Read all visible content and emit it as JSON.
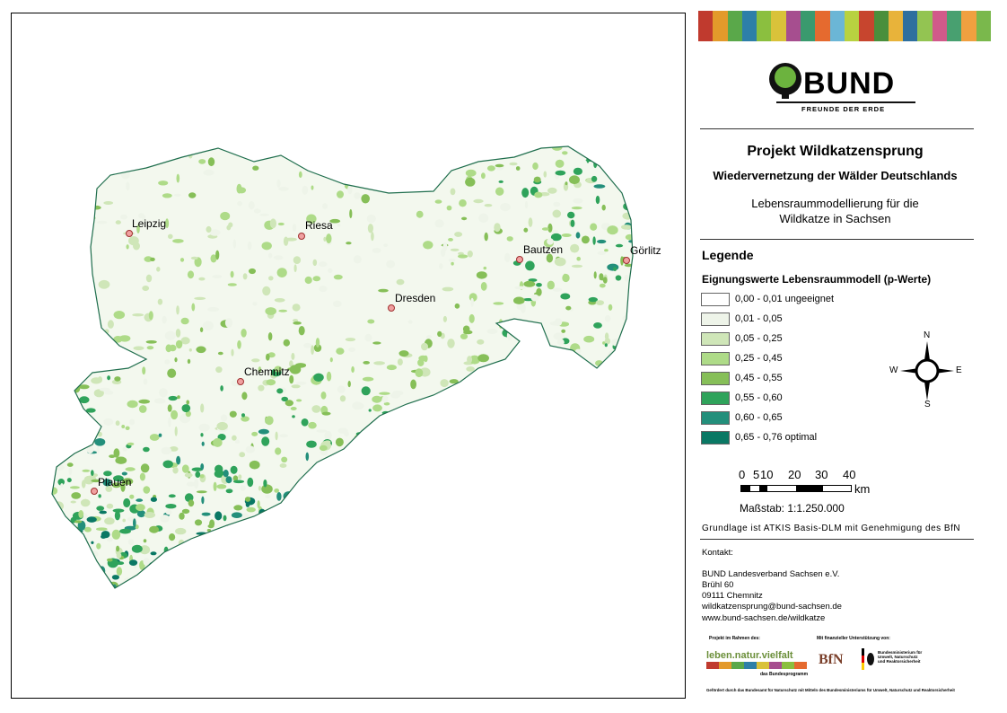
{
  "map": {
    "cities": [
      {
        "id": "leipzig",
        "name": "Leipzig"
      },
      {
        "id": "riesa",
        "name": "Riesa"
      },
      {
        "id": "bautzen",
        "name": "Bautzen"
      },
      {
        "id": "goerlitz",
        "name": "Görlitz"
      },
      {
        "id": "dresden",
        "name": "Dresden"
      },
      {
        "id": "chemnitz",
        "name": "Chemnitz"
      },
      {
        "id": "plauen",
        "name": "Plauen"
      }
    ]
  },
  "header": {
    "logo_text": "BUND",
    "logo_subtext": "FREUNDE DER ERDE",
    "project_title": "Projekt Wildkatzensprung",
    "subtitle": "Wiedervernetzung der Wälder Deutschlands",
    "description_line1": "Lebensraummodellierung für die",
    "description_line2": "Wildkatze in Sachsen"
  },
  "legend": {
    "title": "Legende",
    "subtitle": "Eignungswerte Lebensraummodell (p-Werte)",
    "classes": [
      {
        "label": "0,00 - 0,01 ungeeignet",
        "color": "#ffffff"
      },
      {
        "label": "0,01 - 0,05",
        "color": "#eef4e9"
      },
      {
        "label": "0,05 - 0,25",
        "color": "#cfe6b8"
      },
      {
        "label": "0,25 - 0,45",
        "color": "#aedb88"
      },
      {
        "label": "0,45 - 0,55",
        "color": "#86bf58"
      },
      {
        "label": "0,55 - 0,60",
        "color": "#2fa35b"
      },
      {
        "label": "0,60 - 0,65",
        "color": "#238f7b"
      },
      {
        "label": "0,65 - 0,76 optimal",
        "color": "#0a7864"
      }
    ]
  },
  "compass": {
    "north": "N",
    "south": "S",
    "east": "E",
    "west": "W"
  },
  "scale": {
    "ticks": [
      "0",
      "5",
      "10",
      "20",
      "30",
      "40"
    ],
    "unit": "km",
    "ratio": "Maßstab: 1:1.250.000"
  },
  "source_note": "Grundlage ist ATKIS Basis-DLM mit Genehmigung des BfN",
  "contact": {
    "label": "Kontakt:",
    "lines": [
      "BUND Landesverband Sachsen e.V.",
      "Brühl 60",
      "09111 Chemnitz",
      "wildkatzensprung@bund-sachsen.de",
      "www.bund-sachsen.de/wildkatze"
    ]
  },
  "funders": {
    "program_label": "Projekt im Rahmen des:",
    "program_name": "leben.natur.vielfalt",
    "program_sub": "das Bundesprogramm",
    "support_label": "Mit finanzieller Unterstützung von:",
    "bfn": "BfN",
    "ministry": "Bundesministerium für Umwelt, Naturschutz und Reaktorsicherheit",
    "footer": "Gefördert durch das Bundesamt für Naturschutz mit Mitteln des Bundesministeriums für Umwelt, Naturschutz und Reaktorsicherheit"
  }
}
